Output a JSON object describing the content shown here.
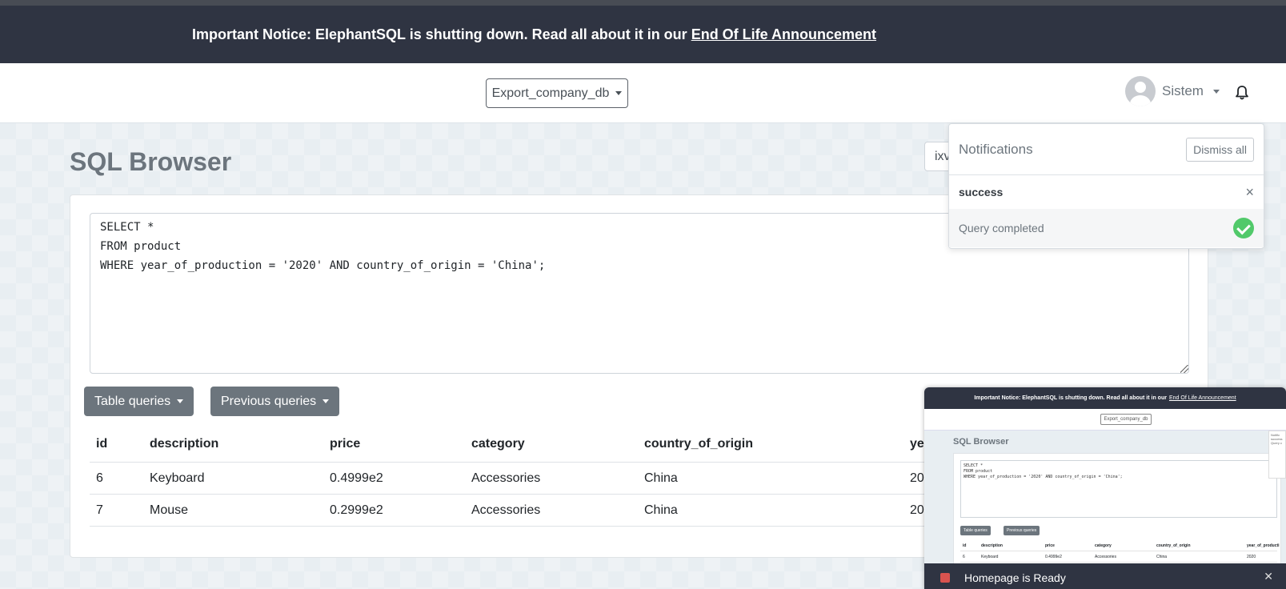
{
  "banner": {
    "text": "Important Notice: ElephantSQL is shutting down. Read all about it in our",
    "link": "End Of Life Announcement"
  },
  "navbar": {
    "database": "Export_company_db",
    "user": "Sistem"
  },
  "page": {
    "title": "SQL Browser",
    "right_input_value": "ixv"
  },
  "editor": {
    "query": "SELECT *\nFROM product\nWHERE year_of_production = '2020' AND country_of_origin = 'China';"
  },
  "buttons": {
    "table_queries": "Table queries",
    "previous_queries": "Previous queries"
  },
  "table": {
    "columns": [
      "id",
      "description",
      "price",
      "category",
      "country_of_origin",
      "ye"
    ],
    "rows": [
      [
        "6",
        "Keyboard",
        "0.4999e2",
        "Accessories",
        "China",
        "20"
      ],
      [
        "7",
        "Mouse",
        "0.2999e2",
        "Accessories",
        "China",
        "20"
      ]
    ]
  },
  "notifications": {
    "title": "Notifications",
    "dismiss_all": "Dismiss all",
    "item_title": "success",
    "item_message": "Query completed",
    "close": "×"
  },
  "thumbnail": {
    "banner_text": "Important Notice: ElephantSQL is shutting down. Read all about it in our",
    "banner_link": "End Of Life Announcement",
    "database": "Export_company_db",
    "title": "SQL Browser",
    "query": "SELECT *\nFROM product\nWHERE year_of_production = '2020' AND country_of_origin = 'China';",
    "table_queries": "Table queries",
    "previous_queries": "Previous queries",
    "columns": [
      "id",
      "description",
      "price",
      "category",
      "country_of_origin",
      "year_of_producti"
    ],
    "row1": [
      "6",
      "Keyboard",
      "0.4999e2",
      "Accessories",
      "China",
      "2020"
    ],
    "bottom_text": "Homepage is Ready",
    "side_text1": "Notific",
    "side_text2": "success",
    "side_text3": "Query c"
  },
  "colors": {
    "banner_bg": "#2f3442",
    "button_gray": "#6c757d",
    "success_green": "#51c96a"
  }
}
